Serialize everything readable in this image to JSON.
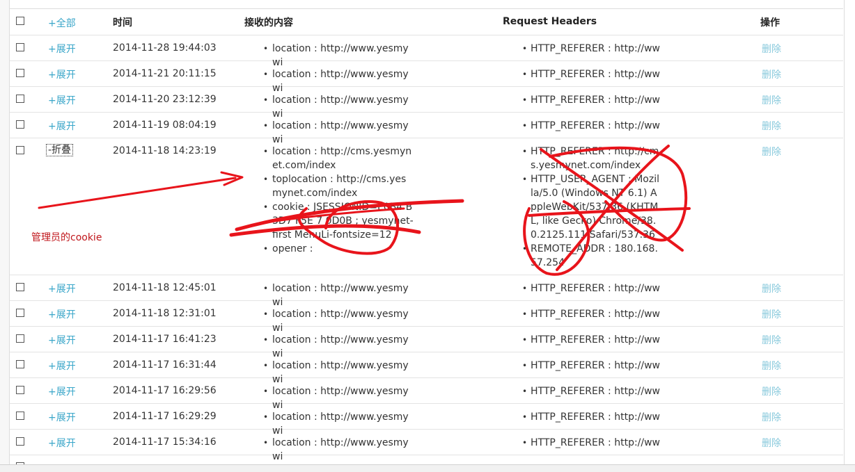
{
  "header": {
    "select_all_label": "+全部",
    "time_label": "时间",
    "content_label": "接收的内容",
    "headers_label": "Request Headers",
    "actions_label": "操作"
  },
  "rows": [
    {
      "toggle": "+展开",
      "time": "2014-11-28 19:44:03",
      "content": [
        "location : http://www.yesmywi"
      ],
      "headers": [
        "HTTP_REFERER : http://ww"
      ],
      "action": "删除"
    },
    {
      "toggle": "+展开",
      "time": "2014-11-21 20:11:15",
      "content": [
        "location : http://www.yesmywi"
      ],
      "headers": [
        "HTTP_REFERER : http://ww"
      ],
      "action": "删除"
    },
    {
      "toggle": "+展开",
      "time": "2014-11-20 23:12:39",
      "content": [
        "location : http://www.yesmywi"
      ],
      "headers": [
        "HTTP_REFERER : http://ww"
      ],
      "action": "删除"
    },
    {
      "toggle": "+展开",
      "time": "2014-11-19 08:04:19",
      "content": [
        "location : http://www.yesmywi"
      ],
      "headers": [
        "HTTP_REFERER : http://ww"
      ],
      "action": "删除"
    },
    {
      "toggle": "-折叠",
      "time": "2014-11-18 14:23:19",
      "content": [
        "location : http://cms.yesmynet.com/index",
        "toplocation : http://cms.yesmynet.com/index",
        "cookie : JSESSIONID=E0B4 B3D7 F5E 7 0D0B ; yesmynet-first MenuLi-fontsize=12",
        "opener :"
      ],
      "headers": [
        "HTTP_REFERER : http://cms.yesmynet.com/index",
        "HTTP_USER_AGENT : Mozilla/5.0 (Windows NT 6.1) AppleWebKit/537.36 (KHTML, like Gecko) Chrome/38.0.2125.111 Safari/537.36",
        "REMOTE_ADDR : 180.168.57.254"
      ],
      "action": "删除"
    },
    {
      "toggle": "+展开",
      "time": "2014-11-18 12:45:01",
      "content": [
        "location : http://www.yesmywi"
      ],
      "headers": [
        "HTTP_REFERER : http://ww"
      ],
      "action": "删除"
    },
    {
      "toggle": "+展开",
      "time": "2014-11-18 12:31:01",
      "content": [
        "location : http://www.yesmywi"
      ],
      "headers": [
        "HTTP_REFERER : http://ww"
      ],
      "action": "删除"
    },
    {
      "toggle": "+展开",
      "time": "2014-11-17 16:41:23",
      "content": [
        "location : http://www.yesmywi"
      ],
      "headers": [
        "HTTP_REFERER : http://ww"
      ],
      "action": "删除"
    },
    {
      "toggle": "+展开",
      "time": "2014-11-17 16:31:44",
      "content": [
        "location : http://www.yesmywi"
      ],
      "headers": [
        "HTTP_REFERER : http://ww"
      ],
      "action": "删除"
    },
    {
      "toggle": "+展开",
      "time": "2014-11-17 16:29:56",
      "content": [
        "location : http://www.yesmywi"
      ],
      "headers": [
        "HTTP_REFERER : http://ww"
      ],
      "action": "删除"
    },
    {
      "toggle": "+展开",
      "time": "2014-11-17 16:29:29",
      "content": [
        "location : http://www.yesmywi"
      ],
      "headers": [
        "HTTP_REFERER : http://ww"
      ],
      "action": "删除"
    },
    {
      "toggle": "+展开",
      "time": "2014-11-17 15:34:16",
      "content": [
        "location : http://www.yesmywi"
      ],
      "headers": [
        "HTTP_REFERER : http://ww"
      ],
      "action": "删除"
    }
  ],
  "annotation": "管理员的cookie",
  "colors": {
    "link": "#3aa6c9",
    "delete_link": "#88c9dc",
    "annotation_red": "#c0161b",
    "scribble_red": "#e8141b"
  }
}
